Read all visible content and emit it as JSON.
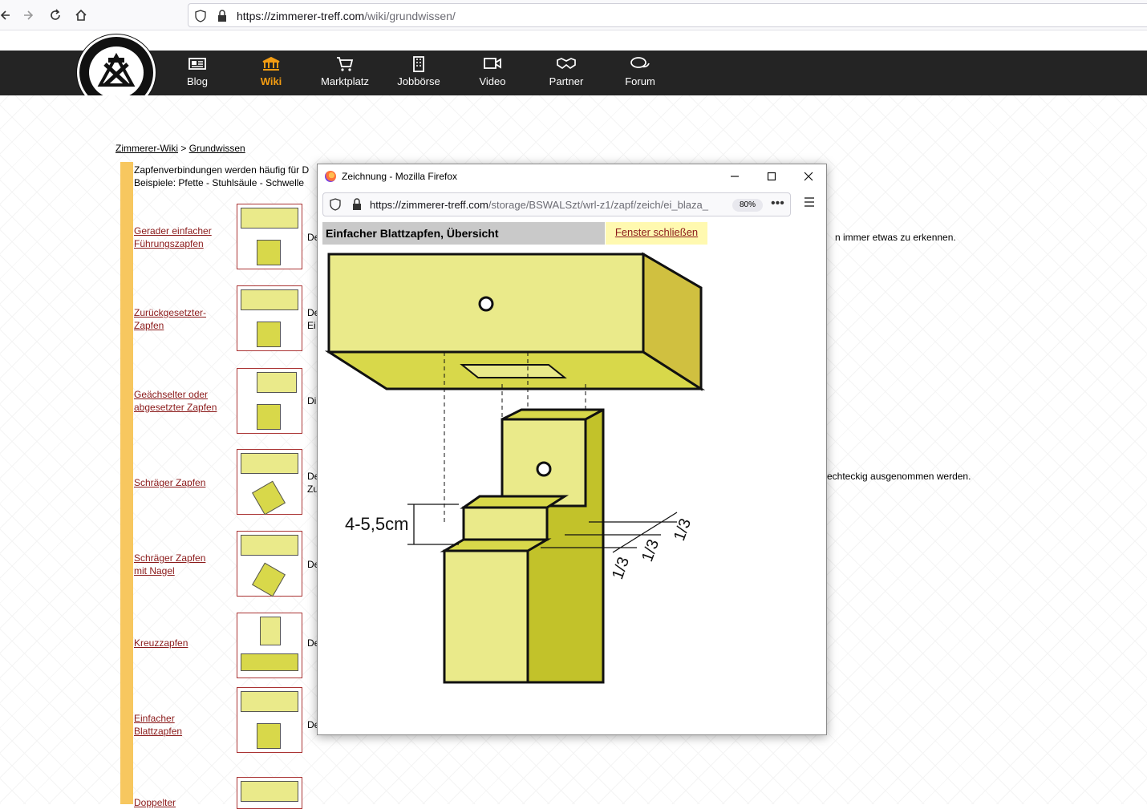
{
  "browser": {
    "url_host": "https://zimmerer-treff.com",
    "url_path": "/wiki/grundwissen/"
  },
  "site": {
    "nav": [
      {
        "label": "Blog"
      },
      {
        "label": "Wiki"
      },
      {
        "label": "Marktplatz"
      },
      {
        "label": "Jobbörse"
      },
      {
        "label": "Video"
      },
      {
        "label": "Partner"
      },
      {
        "label": "Forum"
      }
    ]
  },
  "breadcrumb": {
    "root": "Zimmerer-Wiki",
    "sep": ">",
    "current": "Grundwissen"
  },
  "intro": {
    "line1": "Zapfenverbindungen werden häufig für D",
    "line2": "Beispiele: Pfette - Stuhlsäule - Schwelle"
  },
  "rows": [
    {
      "line1": "Gerader einfacher",
      "line2": "Führungszapfen",
      "text1": "De",
      "text2": ""
    },
    {
      "line1": "Zurückgesetzter-",
      "line2": "Zapfen",
      "text1": "De",
      "text2": "Ei"
    },
    {
      "line1": "Geächselter oder",
      "line2": "abgesetzter Zapfen",
      "text1": "Di",
      "text2": ""
    },
    {
      "line1": "Schräger Zapfen",
      "line2": "",
      "text1": "De",
      "text2": "Zu"
    },
    {
      "line1": "Schräger Zapfen",
      "line2": "mit Nagel",
      "text1": "De",
      "text2": ""
    },
    {
      "line1": "Kreuzzapfen",
      "line2": "",
      "text1": "De",
      "text2": ""
    },
    {
      "line1": "Einfacher",
      "line2": "Blattzapfen",
      "text1": "De",
      "text2": ""
    },
    {
      "line1": "Doppelter",
      "line2": "",
      "text1": "",
      "text2": ""
    }
  ],
  "right_texts": {
    "t1": "n immer etwas zu erkennen.",
    "t2": "echteckig ausgenommen werden."
  },
  "popup": {
    "title": "Zeichnung - Mozilla Firefox",
    "url_host": "https://zimmerer-treff.com",
    "url_path": "/storage/BSWALSzt/wrl-z1/zapf/zeich/ei_blaza_",
    "zoom": "80%",
    "heading": "Einfacher Blattzapfen, Übersicht",
    "close_label": "Fenster schließen",
    "dimension_label": "4-5,5cm",
    "fraction_labels": [
      "1/3",
      "1/3",
      "1/3"
    ]
  },
  "colors": {
    "accent": "#f39c12",
    "header_bg": "#242424",
    "link": "#8b1a1a",
    "wood_light": "#eaea8a",
    "wood_mid": "#d8d84a",
    "wood_dark": "#c2c22a"
  }
}
